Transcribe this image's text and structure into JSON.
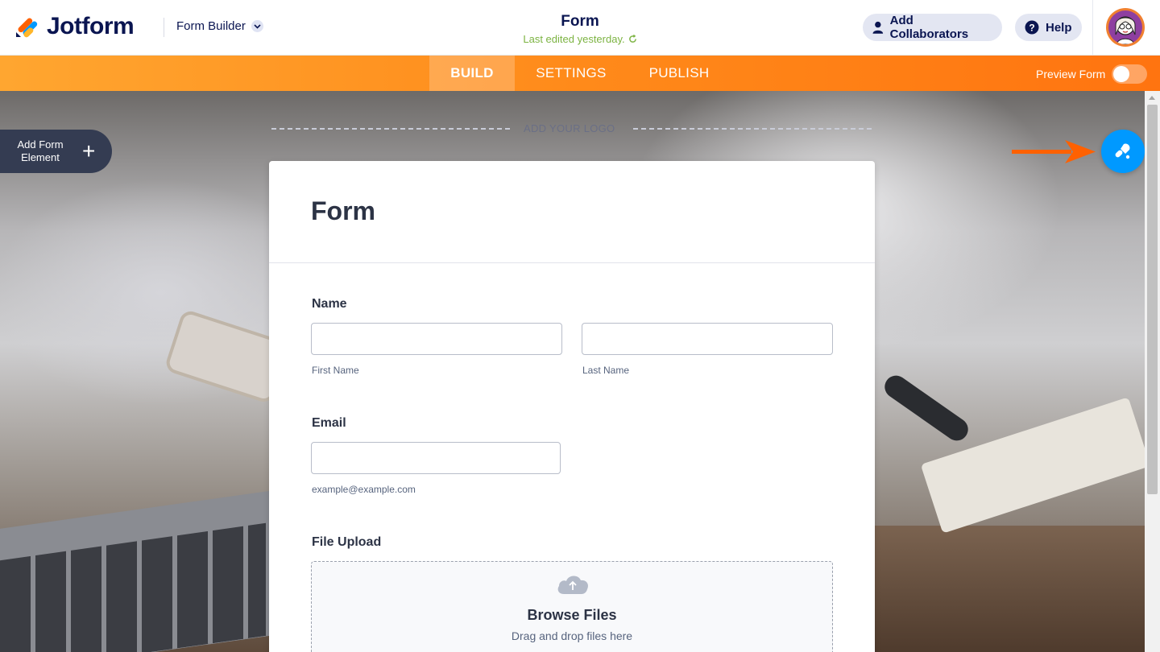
{
  "header": {
    "brand": "Jotform",
    "builder_label": "Form Builder",
    "form_title": "Form",
    "last_edited": "Last edited yesterday.",
    "collaborators_label": "Add Collaborators",
    "help_label": "Help"
  },
  "nav": {
    "tabs": [
      {
        "label": "BUILD",
        "active": true
      },
      {
        "label": "SETTINGS",
        "active": false
      },
      {
        "label": "PUBLISH",
        "active": false
      }
    ],
    "preview_label": "Preview Form",
    "preview_on": false
  },
  "canvas": {
    "logo_placeholder": "ADD YOUR LOGO",
    "add_element_label": "Add Form Element",
    "theme_icon": "paint-roller-icon"
  },
  "form": {
    "heading": "Form",
    "name_label": "Name",
    "first_name_sublabel": "First Name",
    "last_name_sublabel": "Last Name",
    "email_label": "Email",
    "email_sublabel": "example@example.com",
    "upload_label": "File Upload",
    "browse_title": "Browse Files",
    "browse_sub": "Drag and drop files here"
  },
  "colors": {
    "brand_navy": "#0a1551",
    "nav_orange": "#ff8a1a",
    "theme_blue": "#0099ff",
    "edited_green": "#7cb342"
  }
}
